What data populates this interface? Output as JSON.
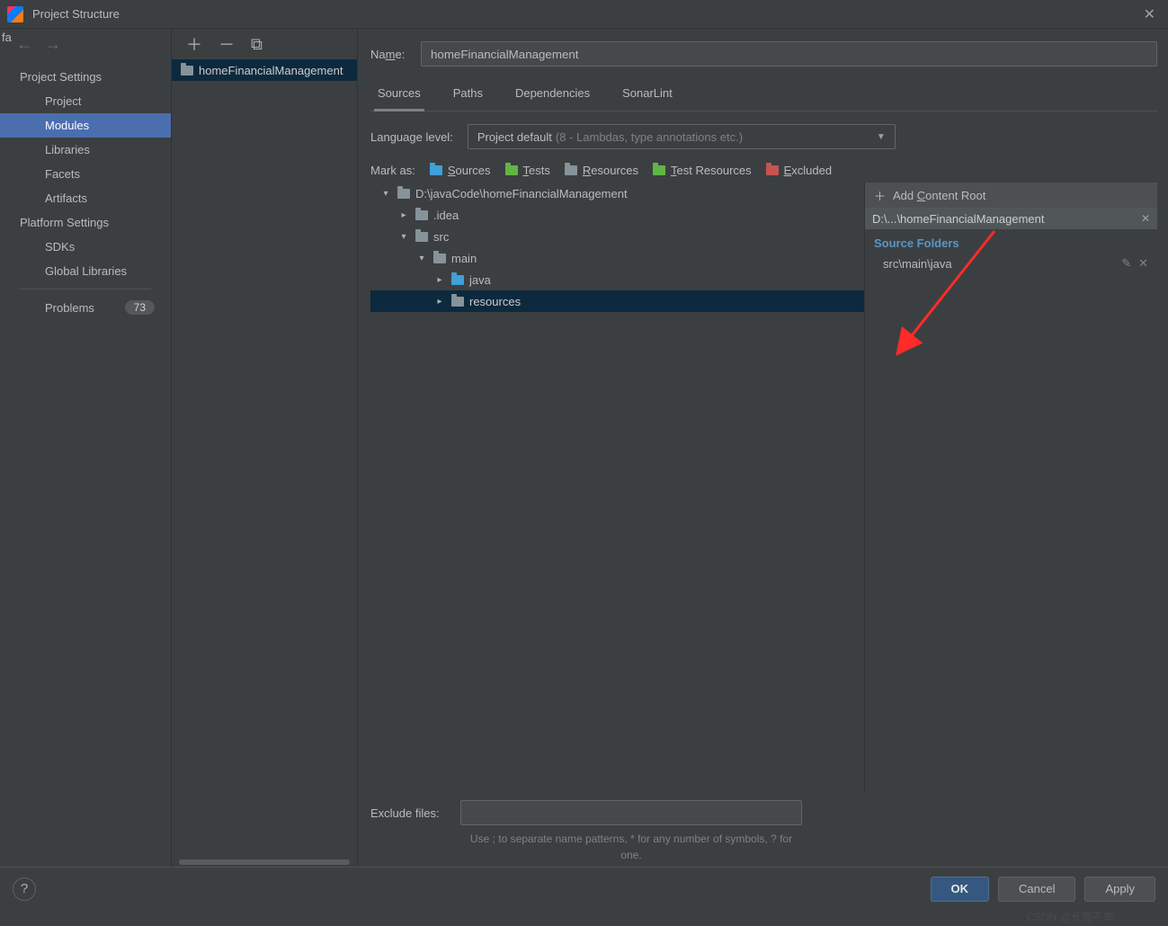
{
  "window": {
    "title": "Project Structure"
  },
  "sidebar": {
    "section1": "Project Settings",
    "items1": [
      "Project",
      "Modules",
      "Libraries",
      "Facets",
      "Artifacts"
    ],
    "selectedIndex": 1,
    "section2": "Platform Settings",
    "items2": [
      "SDKs",
      "Global Libraries"
    ],
    "problems_label": "Problems",
    "problems_count": "73"
  },
  "modules": {
    "item": "homeFinancialManagement"
  },
  "content": {
    "name_label": "Name:",
    "name_value": "homeFinancialManagement",
    "tabs": [
      "Sources",
      "Paths",
      "Dependencies",
      "SonarLint"
    ],
    "active_tab": 0,
    "lang_label": "Language level:",
    "lang_value": "Project default",
    "lang_hint": "(8 - Lambdas, type annotations etc.)",
    "mark_label": "Mark as:",
    "marks": [
      {
        "label": "Sources",
        "color": "blue"
      },
      {
        "label": "Tests",
        "color": "green"
      },
      {
        "label": "Resources",
        "color": "gray"
      },
      {
        "label": "Test Resources",
        "color": "green"
      },
      {
        "label": "Excluded",
        "color": "orange"
      }
    ],
    "tree": [
      {
        "depth": 0,
        "arrow": "down",
        "icon": "gray",
        "label": "D:\\javaCode\\homeFinancialManagement",
        "sel": false
      },
      {
        "depth": 1,
        "arrow": "right",
        "icon": "gray",
        "label": ".idea",
        "sel": false
      },
      {
        "depth": 1,
        "arrow": "down",
        "icon": "gray",
        "label": "src",
        "sel": false
      },
      {
        "depth": 2,
        "arrow": "down",
        "icon": "gray",
        "label": "main",
        "sel": false
      },
      {
        "depth": 3,
        "arrow": "right",
        "icon": "blue",
        "label": "java",
        "sel": false
      },
      {
        "depth": 3,
        "arrow": "right",
        "icon": "gray",
        "label": "resources",
        "sel": true
      }
    ],
    "right": {
      "add_root": "Add Content Root",
      "root_path": "D:\\...\\homeFinancialManagement",
      "section": "Source Folders",
      "folders": [
        "src\\main\\java"
      ]
    },
    "exclude_label": "Exclude files:",
    "exclude_hint": "Use ; to separate name patterns, * for any number of symbols, ? for one."
  },
  "footer": {
    "ok": "OK",
    "cancel": "Cancel",
    "apply": "Apply"
  },
  "watermark": "CSDN @长筒不举"
}
